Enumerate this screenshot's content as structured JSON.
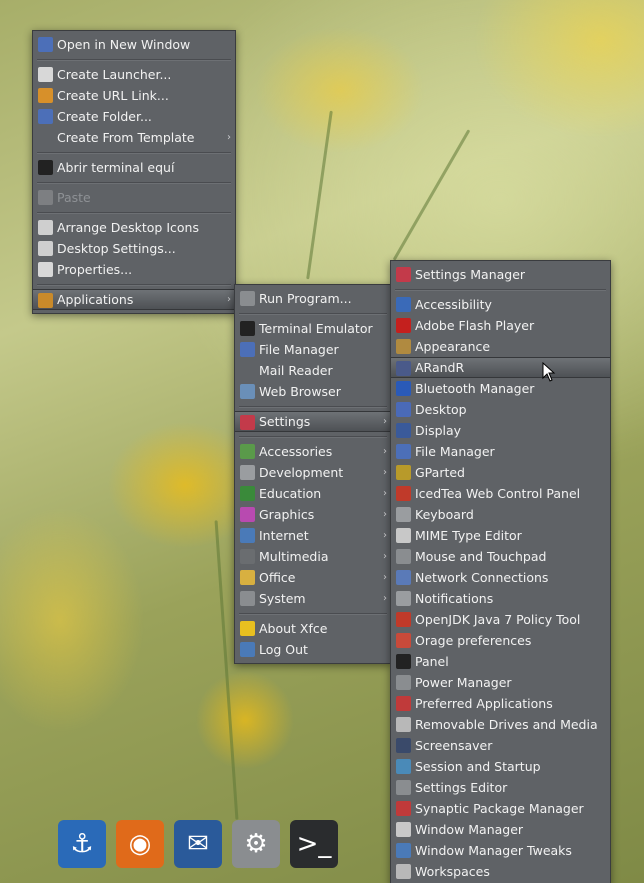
{
  "desktop_menu": {
    "items": [
      {
        "label": "Open in New Window",
        "icon": "folder-open-icon",
        "color": "#4c6fb8"
      },
      {
        "sep": true
      },
      {
        "label": "Create Launcher...",
        "icon": "document-icon",
        "color": "#d8d8d8"
      },
      {
        "label": "Create URL Link...",
        "icon": "link-icon",
        "color": "#d7902a"
      },
      {
        "label": "Create Folder...",
        "icon": "folder-icon",
        "color": "#4c6fb8"
      },
      {
        "label": "Create From Template",
        "icon": "",
        "submenu": true
      },
      {
        "sep": true
      },
      {
        "label": "Abrir terminal equí",
        "icon": "terminal-icon",
        "color": "#222222"
      },
      {
        "sep": true
      },
      {
        "label": "Paste",
        "icon": "paste-icon",
        "color": "#7d7f82",
        "disabled": true
      },
      {
        "sep": true
      },
      {
        "label": "Arrange Desktop Icons",
        "icon": "arrange-icon",
        "color": "#cfcfcf"
      },
      {
        "label": "Desktop Settings...",
        "icon": "desktop-settings-icon",
        "color": "#cfcfcf"
      },
      {
        "label": "Properties...",
        "icon": "properties-icon",
        "color": "#d8d8d8"
      },
      {
        "sep": true
      },
      {
        "label": "Applications",
        "icon": "applications-icon",
        "color": "#c98a2a",
        "submenu": true,
        "active": true
      }
    ]
  },
  "apps_menu": {
    "items": [
      {
        "label": "Run Program...",
        "icon": "run-icon",
        "color": "#8a8d90"
      },
      {
        "sep": true
      },
      {
        "label": "Terminal Emulator",
        "icon": "terminal-icon",
        "color": "#222222"
      },
      {
        "label": "File Manager",
        "icon": "file-manager-icon",
        "color": "#4c6fb8"
      },
      {
        "label": "Mail Reader",
        "icon": ""
      },
      {
        "label": "Web Browser",
        "icon": "web-browser-icon",
        "color": "#6a8fb8"
      },
      {
        "sep": true
      },
      {
        "label": "Settings",
        "icon": "settings-icon",
        "color": "#c33a4a",
        "submenu": true,
        "active": true
      },
      {
        "sep": true
      },
      {
        "label": "Accessories",
        "icon": "accessories-icon",
        "color": "#5a9a4a",
        "submenu": true
      },
      {
        "label": "Development",
        "icon": "development-icon",
        "color": "#9a9da0",
        "submenu": true
      },
      {
        "label": "Education",
        "icon": "education-icon",
        "color": "#3a8a3a",
        "submenu": true
      },
      {
        "label": "Graphics",
        "icon": "graphics-icon",
        "color": "#b84ab0",
        "submenu": true
      },
      {
        "label": "Internet",
        "icon": "internet-icon",
        "color": "#4a7ab8",
        "submenu": true
      },
      {
        "label": "Multimedia",
        "icon": "multimedia-icon",
        "color": "#6a6d70",
        "submenu": true
      },
      {
        "label": "Office",
        "icon": "office-icon",
        "color": "#d8b040",
        "submenu": true
      },
      {
        "label": "System",
        "icon": "system-icon",
        "color": "#8a8d90",
        "submenu": true
      },
      {
        "sep": true
      },
      {
        "label": "About Xfce",
        "icon": "about-icon",
        "color": "#e8c020"
      },
      {
        "label": "Log Out",
        "icon": "logout-icon",
        "color": "#4a7ab8"
      }
    ]
  },
  "settings_menu": {
    "items": [
      {
        "label": "Settings Manager",
        "icon": "settings-manager-icon",
        "color": "#c33a4a"
      },
      {
        "sep": true
      },
      {
        "label": "Accessibility",
        "icon": "accessibility-icon",
        "color": "#3a6ab8"
      },
      {
        "label": "Adobe Flash Player",
        "icon": "flash-icon",
        "color": "#c4201e"
      },
      {
        "label": "Appearance",
        "icon": "appearance-icon",
        "color": "#b08a40"
      },
      {
        "label": "ARandR",
        "icon": "arandr-icon",
        "color": "#4a5a8a",
        "active": true
      },
      {
        "label": "Bluetooth Manager",
        "icon": "bluetooth-icon",
        "color": "#2a5ab8"
      },
      {
        "label": "Desktop",
        "icon": "desktop-icon",
        "color": "#4a6ab8"
      },
      {
        "label": "Display",
        "icon": "display-icon",
        "color": "#3a5a9a"
      },
      {
        "label": "File Manager",
        "icon": "file-manager-icon",
        "color": "#4c6fb8"
      },
      {
        "label": "GParted",
        "icon": "gparted-icon",
        "color": "#b89a2a"
      },
      {
        "label": "IcedTea Web Control Panel",
        "icon": "icedtea-icon",
        "color": "#c03a2a"
      },
      {
        "label": "Keyboard",
        "icon": "keyboard-icon",
        "color": "#9a9da0"
      },
      {
        "label": "MIME Type Editor",
        "icon": "mime-icon",
        "color": "#c8c8c8"
      },
      {
        "label": "Mouse and Touchpad",
        "icon": "mouse-icon",
        "color": "#8a8d90"
      },
      {
        "label": "Network Connections",
        "icon": "network-icon",
        "color": "#5a7ab8"
      },
      {
        "label": "Notifications",
        "icon": "notifications-icon",
        "color": "#9a9da0"
      },
      {
        "label": "OpenJDK Java 7 Policy Tool",
        "icon": "java-icon",
        "color": "#c03a2a"
      },
      {
        "label": "Orage preferences",
        "icon": "orage-icon",
        "color": "#c84a3a"
      },
      {
        "label": "Panel",
        "icon": "panel-icon",
        "color": "#222222"
      },
      {
        "label": "Power Manager",
        "icon": "power-icon",
        "color": "#8a8d90"
      },
      {
        "label": "Preferred Applications",
        "icon": "preferred-apps-icon",
        "color": "#c03a3a"
      },
      {
        "label": "Removable Drives and Media",
        "icon": "drive-icon",
        "color": "#b8b8b8"
      },
      {
        "label": "Screensaver",
        "icon": "screensaver-icon",
        "color": "#3a4a6a"
      },
      {
        "label": "Session and Startup",
        "icon": "session-icon",
        "color": "#4a8ab8"
      },
      {
        "label": "Settings Editor",
        "icon": "settings-editor-icon",
        "color": "#8a8d90"
      },
      {
        "label": "Synaptic Package Manager",
        "icon": "synaptic-icon",
        "color": "#c03a3a"
      },
      {
        "label": "Window Manager",
        "icon": "window-manager-icon",
        "color": "#c8c8c8"
      },
      {
        "label": "Window Manager Tweaks",
        "icon": "wm-tweaks-icon",
        "color": "#4a7ab8"
      },
      {
        "label": "Workspaces",
        "icon": "workspaces-icon",
        "color": "#b8b8b8"
      }
    ]
  },
  "dock": [
    {
      "name": "anchor-launcher-icon",
      "glyph": "⚓",
      "color": "#2a6ab8"
    },
    {
      "name": "firefox-icon",
      "glyph": "◉",
      "color": "#e06a1a"
    },
    {
      "name": "thunderbird-icon",
      "glyph": "✉",
      "color": "#2a5a9a"
    },
    {
      "name": "app-finder-icon",
      "glyph": "⚙",
      "color": "#8a8d90"
    },
    {
      "name": "terminal-launcher-icon",
      "glyph": ">_",
      "color": "#2a2c2e"
    }
  ]
}
